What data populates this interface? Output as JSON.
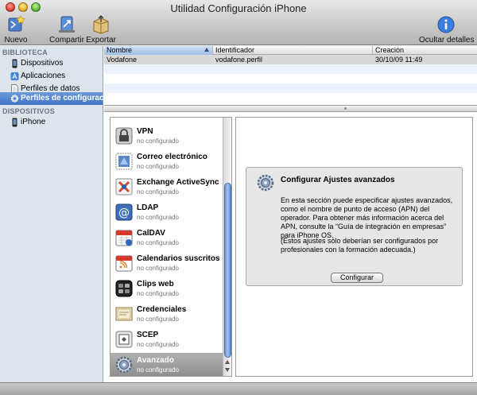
{
  "window": {
    "title": "Utilidad Configuración iPhone"
  },
  "toolbar": {
    "nuevo": "Nuevo",
    "compartir": "Compartir",
    "exportar": "Exportar",
    "ocultar": "Ocultar detalles"
  },
  "sidebar": {
    "library_header": "BIBLIOTECA",
    "library_items": [
      {
        "label": "Dispositivos",
        "icon": "iphone-icon"
      },
      {
        "label": "Aplicaciones",
        "icon": "app-store-icon"
      },
      {
        "label": "Perfiles de datos",
        "icon": "document-icon"
      },
      {
        "label": "Perfiles de configuración",
        "icon": "gear-icon",
        "selected": true
      }
    ],
    "devices_header": "DISPOSITIVOS",
    "device_items": [
      {
        "label": "iPhone",
        "icon": "iphone-icon"
      }
    ]
  },
  "table": {
    "columns": [
      "Nombre",
      "Identificador",
      "Creación"
    ],
    "rows": [
      {
        "nombre": "Vodafone",
        "identificador": "vodafone.perfil",
        "creacion": "30/10/09 11:49"
      }
    ]
  },
  "payloads": [
    {
      "name": "VPN",
      "status": "no configurado",
      "icon": "lock-icon"
    },
    {
      "name": "Correo electrónico",
      "status": "no configurado",
      "icon": "mail-stamp-icon"
    },
    {
      "name": "Exchange ActiveSync",
      "status": "no configurado",
      "icon": "exchange-icon"
    },
    {
      "name": "LDAP",
      "status": "no configurado",
      "icon": "at-sign-icon"
    },
    {
      "name": "CalDAV",
      "status": "no configurado",
      "icon": "calendar-icon"
    },
    {
      "name": "Calendarios suscritos",
      "status": "no configurado",
      "icon": "calendar-rss-icon"
    },
    {
      "name": "Clips web",
      "status": "no configurado",
      "icon": "web-clip-icon"
    },
    {
      "name": "Credenciales",
      "status": "no configurado",
      "icon": "certificate-icon"
    },
    {
      "name": "SCEP",
      "status": "no configurado",
      "icon": "scep-icon"
    },
    {
      "name": "Avanzado",
      "status": "no configurado",
      "icon": "advanced-gear-icon",
      "selected": true
    }
  ],
  "detail": {
    "title": "Configurar Ajustes avanzados",
    "description": "En esta sección puede especificar ajustes avanzados, como el nombre de punto de acceso (APN) del operador. Para obtener más información acerca del APN, consulte la “Guía de integración en empresas” para iPhone OS.",
    "note": "(Estos ajustes sólo deberían ser configurados por profesionales con la formación adecuada.)",
    "button": "Configurar"
  }
}
